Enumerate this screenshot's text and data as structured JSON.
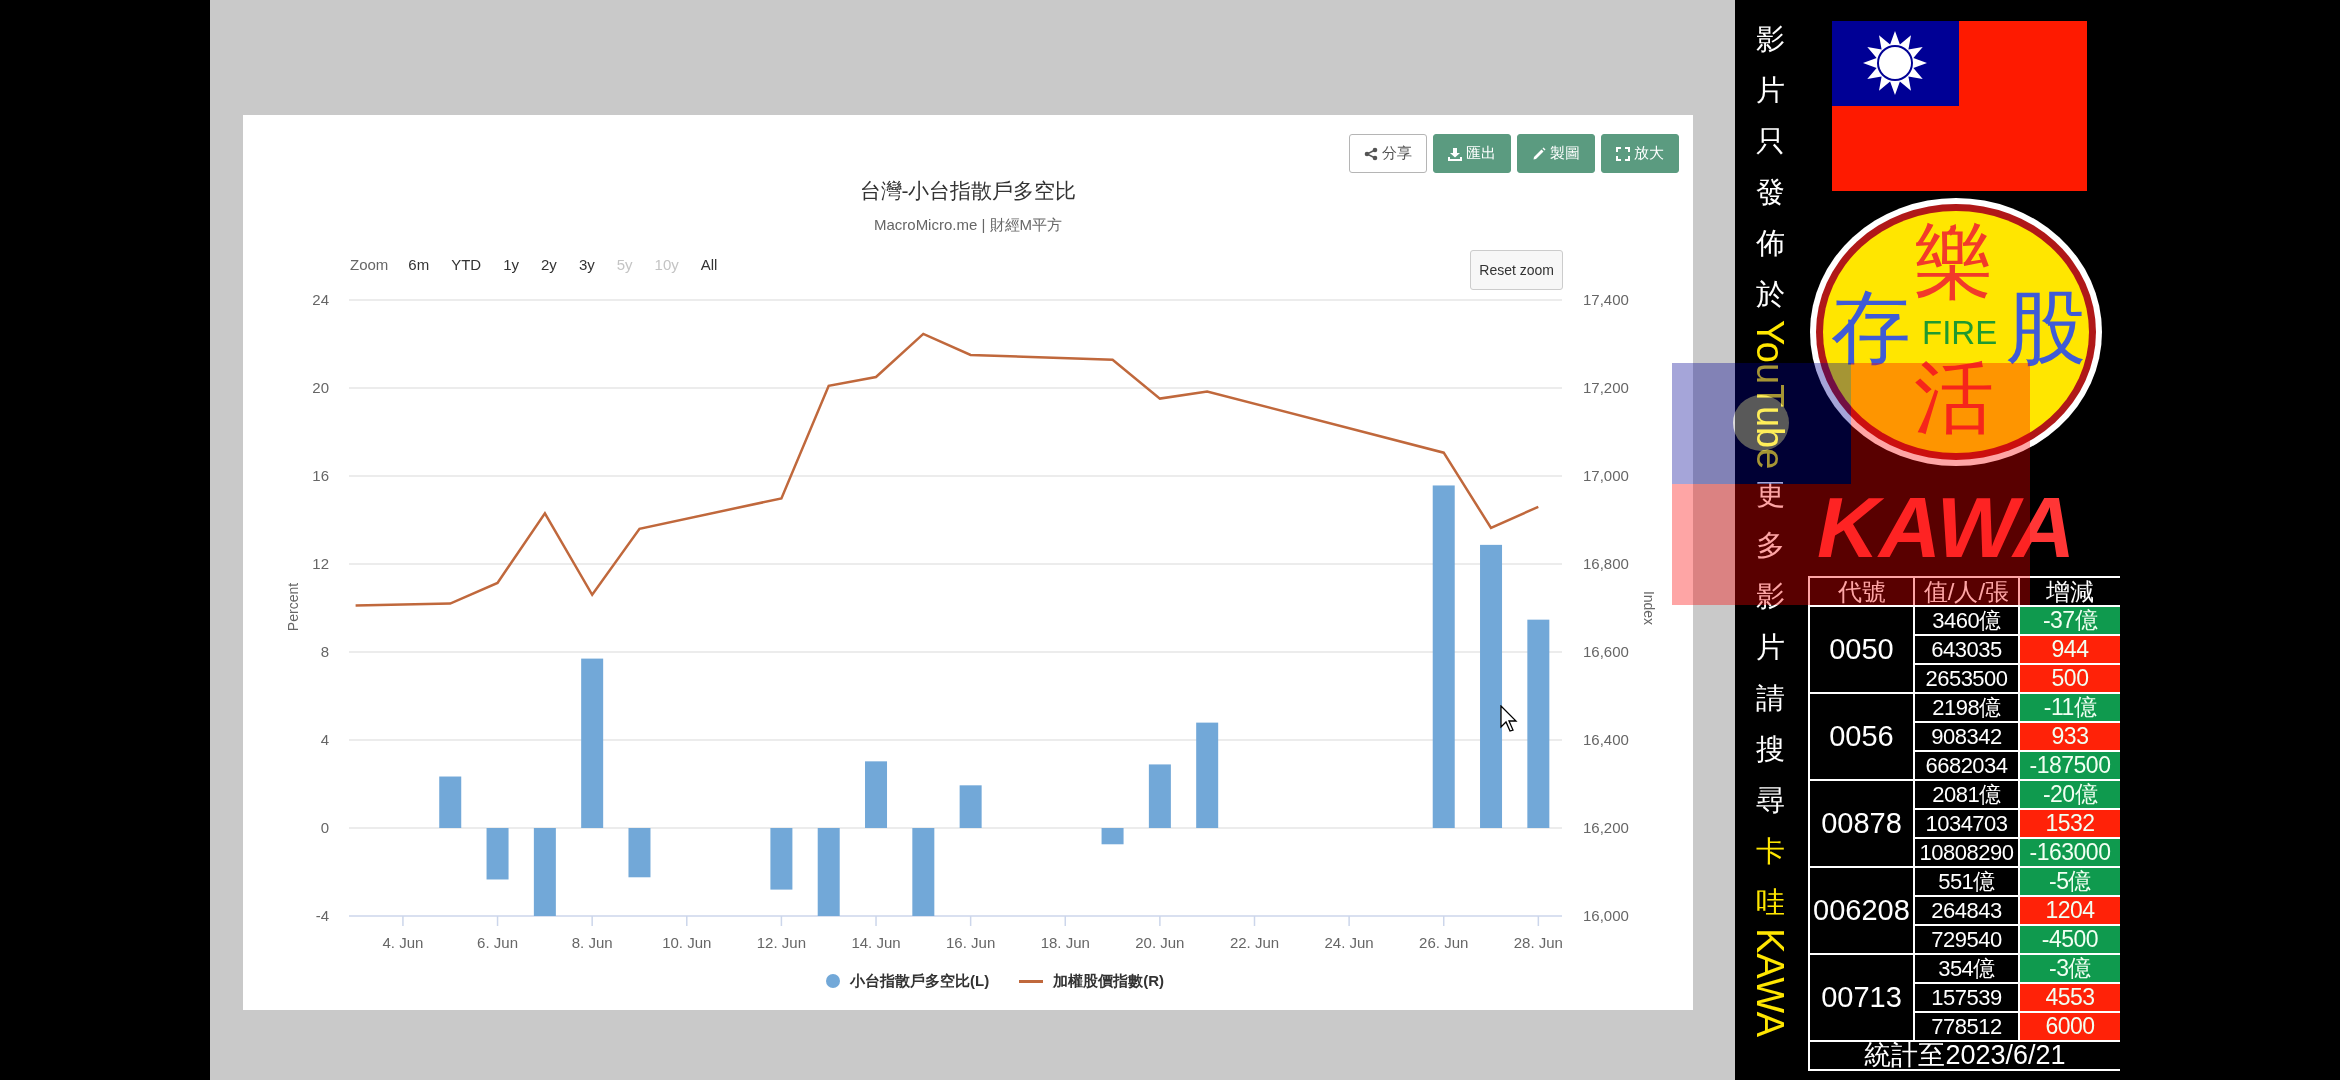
{
  "chart_panel": {
    "toolbar": [
      {
        "label": "分享",
        "kind": "share"
      },
      {
        "label": "匯出",
        "kind": "export"
      },
      {
        "label": "製圖",
        "kind": "draw"
      },
      {
        "label": "放大",
        "kind": "fullscreen"
      }
    ],
    "title": "台灣-小台指散戶多空比",
    "subtitle": "MacroMicro.me | 財經M平方",
    "range_selector": {
      "label": "Zoom",
      "options": [
        {
          "label": "6m",
          "disabled": false
        },
        {
          "label": "YTD",
          "disabled": false
        },
        {
          "label": "1y",
          "disabled": false
        },
        {
          "label": "2y",
          "disabled": false
        },
        {
          "label": "3y",
          "disabled": false
        },
        {
          "label": "5y",
          "disabled": true
        },
        {
          "label": "10y",
          "disabled": true
        },
        {
          "label": "All",
          "disabled": false
        }
      ]
    },
    "reset_zoom": "Reset zoom",
    "chart_data": {
      "type": "bar",
      "ylabel": "Percent",
      "grid": true,
      "categories": [
        null,
        "4. Jun",
        null,
        "6. Jun",
        null,
        "8. Jun",
        null,
        "10. Jun",
        null,
        "12. Jun",
        null,
        "14. Jun",
        null,
        "16. Jun",
        null,
        "18. Jun",
        null,
        "20. Jun",
        null,
        "22. Jun",
        null,
        "24. Jun",
        null,
        "26. Jun",
        null,
        "28. Jun"
      ],
      "ylim": [
        -4,
        24
      ],
      "yticks": [
        -4,
        0,
        4,
        8,
        12,
        16,
        20,
        24
      ],
      "series": [
        {
          "name": "小台指散戶多空比(L)",
          "color": "#72a8d8",
          "values": [
            null,
            null,
            2.34,
            -2.34,
            -4,
            7.7,
            -2.24,
            null,
            null,
            -2.8,
            -4,
            3.03,
            -4,
            1.94,
            null,
            null,
            -0.74,
            2.89,
            4.79,
            null,
            null,
            null,
            null,
            15.57,
            12.87,
            9.47
          ]
        }
      ]
    },
    "index_overlay": {
      "chart_data": {
        "type": "line",
        "ylabel": "Index",
        "categories": [
          null,
          null,
          null,
          null,
          null,
          null,
          null,
          null,
          null,
          null,
          null,
          null,
          null,
          null,
          null,
          null,
          null,
          null,
          null,
          null,
          null,
          null,
          null,
          null,
          null,
          null
        ],
        "ylim": [
          16000,
          17400
        ],
        "yticks": [
          {
            "value": 16000,
            "label": "16,000"
          },
          {
            "value": 16200,
            "label": "16,200"
          },
          {
            "value": 16400,
            "label": "16,400"
          },
          {
            "value": 16600,
            "label": "16,600"
          },
          {
            "value": 16800,
            "label": "16,800"
          },
          {
            "value": 17000,
            "label": "17,000"
          },
          {
            "value": 17200,
            "label": "17,200"
          },
          {
            "value": 17400,
            "label": "17,400"
          }
        ],
        "series": [
          {
            "name": "加權股價指數(R)",
            "color": "#c0683c",
            "values": [
              16706,
              null,
              16710,
              16757,
              16915,
              16730,
              16880,
              null,
              null,
              16949,
              17205,
              17225,
              17323,
              17275,
              null,
              null,
              17264,
              17176,
              17192,
              null,
              null,
              null,
              null,
              17053,
              16882,
              16930
            ]
          }
        ]
      }
    }
  },
  "side_caption": [
    {
      "text": "影片只發佈於",
      "kind": "stacked",
      "highlight": false
    },
    {
      "text": "YouTube",
      "kind": "sideways",
      "highlight": true
    },
    {
      "text": "更多影片請搜尋",
      "kind": "stacked",
      "highlight": false
    },
    {
      "text": "卡哇",
      "kind": "stacked",
      "highlight": true
    },
    {
      "text": "KAWA",
      "kind": "sideways",
      "highlight": true
    }
  ],
  "logo": {
    "top": "樂",
    "left": "存",
    "center": "FIRE",
    "right": "股",
    "bottom": "活"
  },
  "brand": "KAWA",
  "holdings_table": {
    "columns": [
      "代號",
      "值/人/張",
      "增減"
    ],
    "rows": [
      {
        "code": "0050",
        "lines": [
          {
            "value": "3460億",
            "change": "-37億",
            "color": "#0f9a4e"
          },
          {
            "value": "643035",
            "change": "944",
            "color": "#ff2208"
          },
          {
            "value": "2653500",
            "change": "500",
            "color": "#ff2208"
          }
        ]
      },
      {
        "code": "0056",
        "lines": [
          {
            "value": "2198億",
            "change": "-11億",
            "color": "#0f9a4e"
          },
          {
            "value": "908342",
            "change": "933",
            "color": "#ff2208"
          },
          {
            "value": "6682034",
            "change": "-187500",
            "color": "#0f9a4e"
          }
        ]
      },
      {
        "code": "00878",
        "lines": [
          {
            "value": "2081億",
            "change": "-20億",
            "color": "#0f9a4e"
          },
          {
            "value": "1034703",
            "change": "1532",
            "color": "#ff2208"
          },
          {
            "value": "10808290",
            "change": "-163000",
            "color": "#0f9a4e"
          }
        ]
      },
      {
        "code": "006208",
        "lines": [
          {
            "value": "551億",
            "change": "-5億",
            "color": "#0f9a4e"
          },
          {
            "value": "264843",
            "change": "1204",
            "color": "#ff2208"
          },
          {
            "value": "729540",
            "change": "-4500",
            "color": "#0f9a4e"
          }
        ]
      },
      {
        "code": "00713",
        "lines": [
          {
            "value": "354億",
            "change": "-3億",
            "color": "#0f9a4e"
          },
          {
            "value": "157539",
            "change": "4553",
            "color": "#ff2208"
          },
          {
            "value": "778512",
            "change": "6000",
            "color": "#ff2208"
          }
        ]
      }
    ],
    "footer": "統計至2023/6/21"
  }
}
